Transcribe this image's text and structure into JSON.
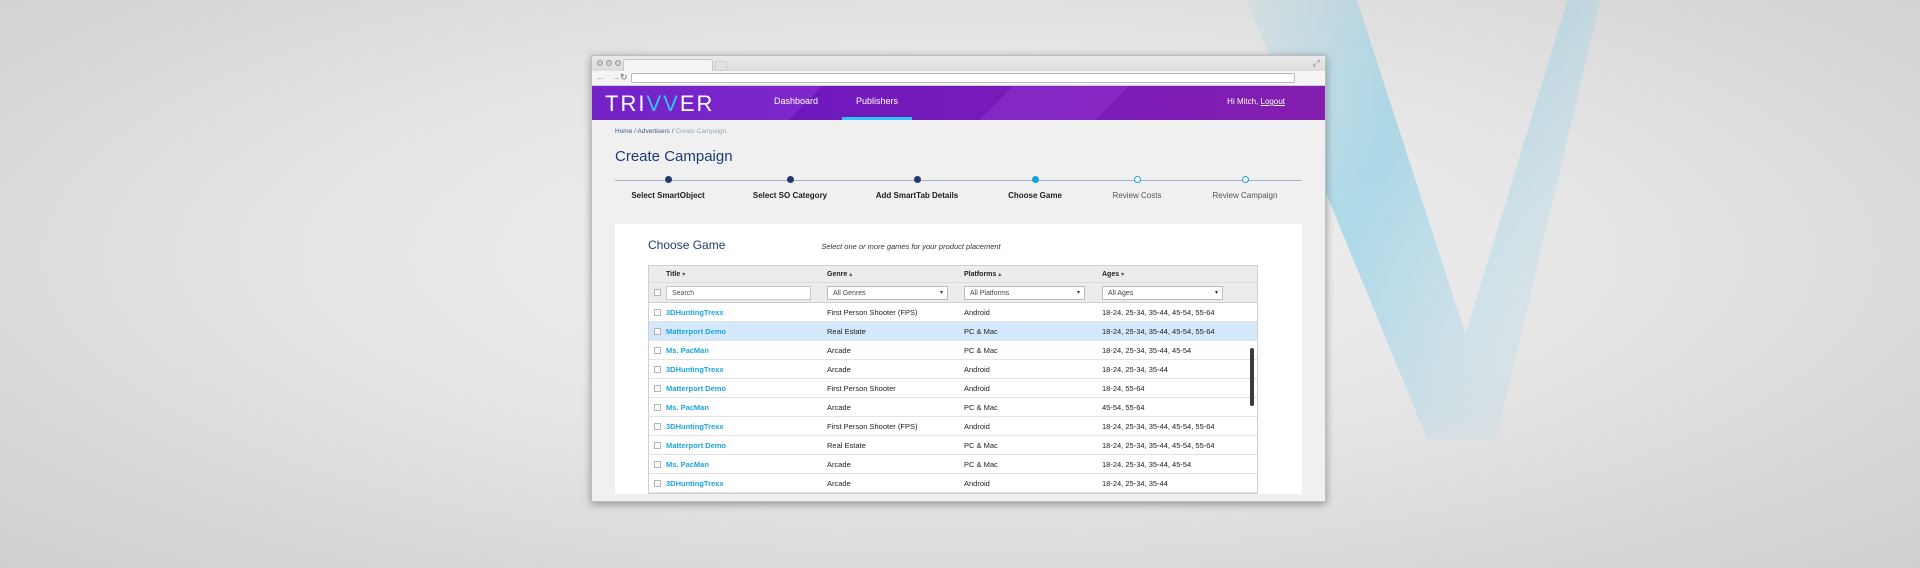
{
  "brand": {
    "logo_before": "TRI",
    "logo_v": "VV",
    "logo_after": "ER"
  },
  "nav": {
    "items": [
      {
        "label": "Dashboard"
      },
      {
        "label": "Publishers"
      }
    ]
  },
  "user": {
    "greeting": "Hi Mitch,",
    "logout": "Logout"
  },
  "breadcrumb": {
    "home": "Home",
    "sep1": " / ",
    "advertisers": "Advertisers",
    "sep2": " / ",
    "current": "Create Campaign"
  },
  "page_title": "Create Campaign",
  "steps": [
    {
      "label": "Select SmartObject",
      "state": "done"
    },
    {
      "label": "Select SO Category",
      "state": "done"
    },
    {
      "label": "Add SmartTab Details",
      "state": "done"
    },
    {
      "label": "Choose Game",
      "state": "current"
    },
    {
      "label": "Review Costs",
      "state": "todo"
    },
    {
      "label": "Review Campaign",
      "state": "todo"
    }
  ],
  "panel": {
    "title": "Choose Game",
    "hint": "Select one or more games for your product placement"
  },
  "table": {
    "headers": {
      "title": "Title",
      "genre": "Genre",
      "platforms": "Platforms",
      "ages": "Ages"
    },
    "sort_glyphs": {
      "title": "▾",
      "genre": "▴",
      "platforms": "▴",
      "ages": "▾"
    },
    "filters": {
      "search_placeholder": "Search",
      "genre": "All Genres",
      "platforms": "All Platforms",
      "ages": "All Ages",
      "caret": "▾"
    },
    "rows": [
      {
        "title": "3DHuntingTrexx",
        "genre": "First Person Shooter (FPS)",
        "platform": "Android",
        "ages": "18-24, 25-34, 35-44, 45-54, 55-64"
      },
      {
        "title": "Matterport Demo",
        "genre": "Real Estate",
        "platform": "PC & Mac",
        "ages": "18-24, 25-34, 35-44, 45-54, 55-64"
      },
      {
        "title": "Ms. PacMan",
        "genre": "Arcade",
        "platform": "PC & Mac",
        "ages": "18-24, 25-34, 35-44, 45-54"
      },
      {
        "title": "3DHuntingTrexx",
        "genre": "Arcade",
        "platform": "Android",
        "ages": "18-24, 25-34, 35-44"
      },
      {
        "title": "Matterport Demo",
        "genre": "First Person Shooter",
        "platform": "Android",
        "ages": "18-24,  55-64"
      },
      {
        "title": "Ms. PacMan",
        "genre": "Arcade",
        "platform": "PC & Mac",
        "ages": "45-54, 55-64"
      },
      {
        "title": "3DHuntingTrexx",
        "genre": "First Person Shooter (FPS)",
        "platform": "Android",
        "ages": "18-24, 25-34, 35-44, 45-54, 55-64"
      },
      {
        "title": "Matterport Demo",
        "genre": "Real Estate",
        "platform": "PC & Mac",
        "ages": "18-24, 25-34, 35-44, 45-54, 55-64"
      },
      {
        "title": "Ms. PacMan",
        "genre": "Arcade",
        "platform": "PC & Mac",
        "ages": "18-24, 25-34, 35-44, 45-54"
      },
      {
        "title": "3DHuntingTrexx",
        "genre": "Arcade",
        "platform": "Android",
        "ages": "18-24, 25-34, 35-44"
      }
    ],
    "highlighted_row": 1
  },
  "colors": {
    "header": "#7a1cc8",
    "accent": "#2fc3ff",
    "title_blue": "#1f3a73",
    "link_blue": "#1ea3e0",
    "highlight": "#d5e8fb"
  }
}
